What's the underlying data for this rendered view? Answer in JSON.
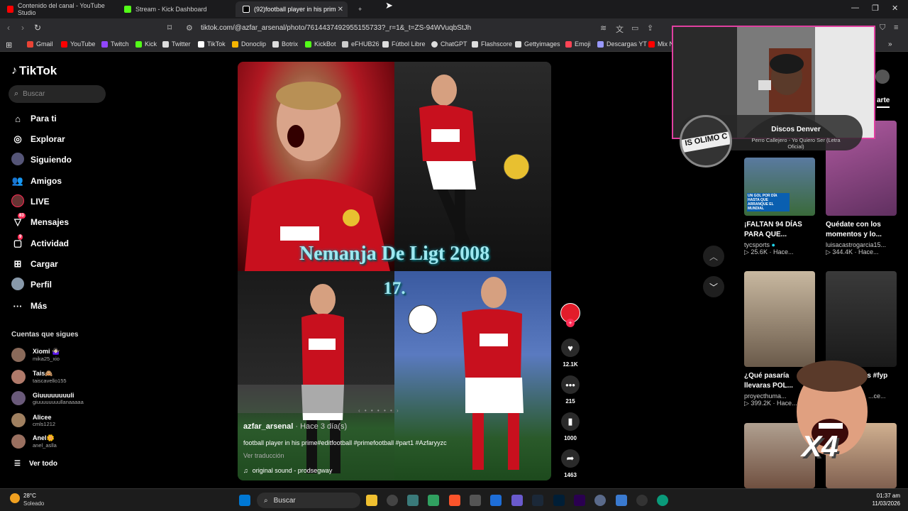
{
  "browser": {
    "tabs": [
      {
        "label": "Contenido del canal - YouTube Studio",
        "color": "#ff0000"
      },
      {
        "label": "Stream - Kick Dashboard",
        "color": "#53fc18"
      },
      {
        "label": "(92)football player in his prim",
        "color": "#ffffff"
      }
    ],
    "new_tab": "+",
    "url": "tiktok.com/@azfar_arsenal/photo/7614437492955155733?_r=1&_t=ZS-94WVuqbStJh",
    "bookmarks": [
      {
        "label": "Gmail",
        "color": "#ea4335"
      },
      {
        "label": "YouTube",
        "color": "#ff0000"
      },
      {
        "label": "Twitch",
        "color": "#9146ff"
      },
      {
        "label": "Kick",
        "color": "#53fc18"
      },
      {
        "label": "Twitter",
        "color": "#dddddd"
      },
      {
        "label": "TikTok",
        "color": "#ffffff"
      },
      {
        "label": "Donoclip",
        "color": "#f5b400"
      },
      {
        "label": "Botrix",
        "color": "#dddddd"
      },
      {
        "label": "KickBot",
        "color": "#53fc18"
      },
      {
        "label": "eFHUB26",
        "color": "#cccccc"
      },
      {
        "label": "Fútbol Libre",
        "color": "#dddddd"
      },
      {
        "label": "ChatGPT",
        "color": "#dddddd"
      },
      {
        "label": "Flashscore",
        "color": "#dddddd"
      },
      {
        "label": "Gettyimages",
        "color": "#dddddd"
      },
      {
        "label": "Emoji",
        "color": "#ff4455"
      },
      {
        "label": "Descargas YT",
        "color": "#9999ff"
      },
      {
        "label": "Mix N",
        "color": "#ff0000"
      }
    ]
  },
  "tiktok": {
    "logo": "TikTok",
    "search_placeholder": "Buscar",
    "nav": [
      {
        "label": "Para ti",
        "icon": "home-icon"
      },
      {
        "label": "Explorar",
        "icon": "compass-icon"
      },
      {
        "label": "Siguiendo",
        "icon": "following-icon"
      },
      {
        "label": "Amigos",
        "icon": "friends-icon"
      },
      {
        "label": "LIVE",
        "icon": "live-icon"
      },
      {
        "label": "Mensajes",
        "icon": "messages-icon",
        "badge": "83"
      },
      {
        "label": "Actividad",
        "icon": "activity-icon",
        "badge": "9"
      },
      {
        "label": "Cargar",
        "icon": "upload-icon"
      },
      {
        "label": "Perfil",
        "icon": "profile-icon"
      },
      {
        "label": "Más",
        "icon": "more-icon"
      }
    ],
    "following_title": "Cuentas que sigues",
    "following": [
      {
        "name": "Xiomi 🤷🏻‍♀️",
        "handle": "mika25_xio",
        "color": "#8a6a5a"
      },
      {
        "name": "Tais🙈",
        "handle": "taiscavello155",
        "color": "#b07a6a"
      },
      {
        "name": "Giuuuuuuuuli",
        "handle": "giuuuuuuuullanaaaaa",
        "color": "#6a5a7a"
      },
      {
        "name": "Alicee",
        "handle": "cmls1212",
        "color": "#a08060"
      },
      {
        "name": "Anel🌼",
        "handle": "anel_aslla",
        "color": "#9a7060"
      }
    ],
    "see_all": "Ver todo"
  },
  "post": {
    "overlay_title": "Nemanja De Ligt 2008",
    "overlay_number": "17.",
    "username": "azfar_arsenal",
    "time": " · Hace 3 día(s)",
    "caption": "football player in his prime#editfootball #primefootball #part1 #Azfaryyzc",
    "translate": "Ver traducción",
    "sound": "original sound - prodsegway",
    "likes": "12.1K",
    "comments": "215",
    "saves": "1000",
    "shares": "1463"
  },
  "right_column": {
    "tab_label": "arte",
    "cards": [
      {
        "title": "¡FALTAN 94 DÍAS PARA QUE...",
        "user": "tycsports",
        "meta": "▷ 25.6K · Hace...",
        "thumb_text": "UN GOL POR DÍA HASTA QUE ARRANQUE EL MUNDIAL"
      },
      {
        "title": "Quédate con los momentos y lo...",
        "user": "luisacastrogarcia15...",
        "meta": "▷ 344.4K · Hace..."
      },
      {
        "title": "¿Qué pasaría llevaras POL...",
        "user": "proyecthuma...",
        "meta": "▷ 399.2K · Hace..."
      },
      {
        "title": "...s #fyp",
        "user": "",
        "meta": "...ce..."
      }
    ]
  },
  "stream_overlay": {
    "song_title": "Discos Denver",
    "song_subtitle": "Perro Callejero - Yo Quiero Ser (Letra Oficial)",
    "multiplier": "X4"
  },
  "taskbar": {
    "weather_temp": "28°C",
    "weather_desc": "Soleado",
    "search": "Buscar",
    "time": "01:37 am",
    "date": "11/03/2026"
  }
}
